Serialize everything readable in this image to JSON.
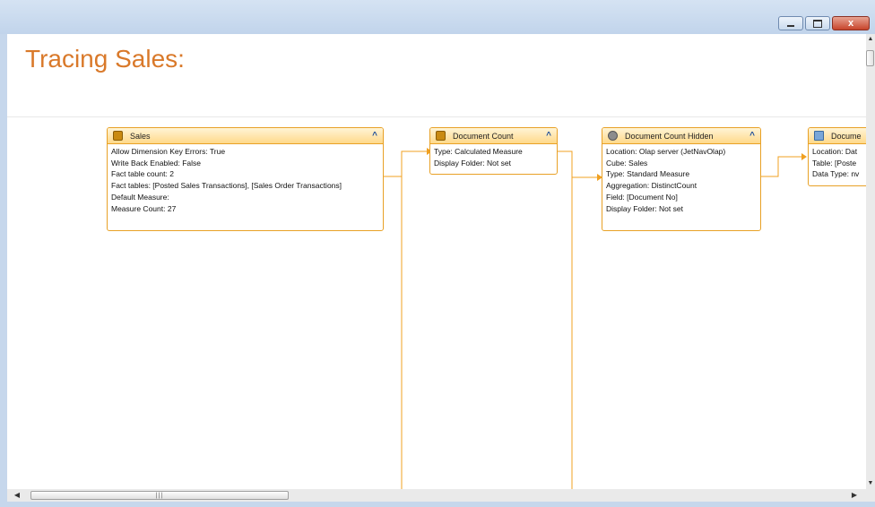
{
  "window": {
    "controls": {
      "minimize": "minimize",
      "maximize": "maximize",
      "close": "x"
    }
  },
  "page": {
    "title": "Tracing Sales:"
  },
  "nodes": [
    {
      "title": "Sales",
      "icon": "cube-icon",
      "rows": [
        "Allow Dimension Key Errors: True",
        "Write Back Enabled: False",
        "Fact table count: 2",
        "Fact tables: [Posted Sales Transactions], [Sales Order Transactions]",
        "Default Measure:",
        "Measure Count: 27"
      ]
    },
    {
      "title": "Document Count",
      "icon": "measure-icon",
      "rows": [
        "Type: Calculated Measure",
        "Display Folder: Not set"
      ]
    },
    {
      "title": "Document Count Hidden",
      "icon": "measure-icon",
      "rows": [
        "Location: Olap server (JetNavOlap)",
        "Cube: Sales",
        "Type: Standard Measure",
        "Aggregation: DistinctCount",
        "Field: [Document No]",
        "Display Folder: Not set"
      ]
    },
    {
      "title": "Docume",
      "icon": "table-icon",
      "rows": [
        "Location: Dat",
        "Table: [Poste",
        "Data Type: nv"
      ]
    }
  ],
  "colors": {
    "accent": "#d9792a",
    "node_border": "#e8a126",
    "link": "#f0a020"
  }
}
